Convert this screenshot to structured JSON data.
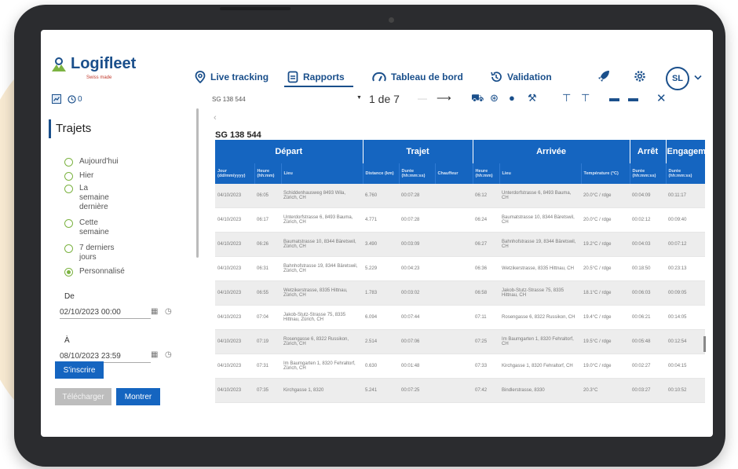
{
  "app": {
    "brand": "Logifleet",
    "brand_sub": "Swiss made",
    "user_initials": "SL"
  },
  "nav": {
    "items": [
      {
        "label": "Live tracking",
        "icon": "location-pin-icon"
      },
      {
        "label": "Rapports",
        "icon": "document-icon"
      },
      {
        "label": "Tableau de bord",
        "icon": "dashboard-icon"
      },
      {
        "label": "Validation",
        "icon": "history-icon"
      }
    ],
    "active": "Rapports"
  },
  "sidebar": {
    "counter": "0",
    "title": "Trajets",
    "periods": [
      "Aujourd'hui",
      "Hier",
      "La semaine dernière",
      "Cette semaine",
      "7 derniers jours",
      "Personnalisé"
    ],
    "selected_period": "Personnalisé",
    "from_label": "De",
    "from_value": "02/10/2023 00:00",
    "to_label": "À",
    "to_value": "08/10/2023 23:59",
    "subscribe_label": "S'inscrire",
    "download_label": "Télécharger",
    "show_label": "Montrer"
  },
  "toolbar": {
    "vehicle": "SG 138 544",
    "pager": "1 de 7"
  },
  "report": {
    "title": "SG 138 544",
    "groups": [
      {
        "label": "Départ",
        "span": 3
      },
      {
        "label": "Trajet",
        "span": 3
      },
      {
        "label": "Arrivée",
        "span": 3
      },
      {
        "label": "Arrêt",
        "span": 1
      },
      {
        "label": "Engageme",
        "span": 1
      }
    ],
    "columns": [
      "Jour (dd/mm/yyyy)",
      "Heure (hh:mm)",
      "Lieu",
      "Distance (km)",
      "Durée (hh:mm:ss)",
      "Chauffeur",
      "Heure (hh:mm)",
      "Lieu",
      "Température (°C)",
      "Durée (hh:mm:ss)",
      "Durée (hh:mm:ss)"
    ],
    "rows": [
      [
        "04/10/2023",
        "06:05",
        "Schiddenhausweg 8493 Wila, Zürich, CH",
        "6.760",
        "00:07:28",
        "",
        "06:12",
        "Unterdorfstrasse 6, 8493 Bauma, CH",
        "20.0°C / rdge",
        "00:04:09",
        "00:11:17"
      ],
      [
        "04/10/2023",
        "06:17",
        "Unterdorfstrasse 6, 8493 Bauma, Zürich, CH",
        "4.771",
        "00:07:28",
        "",
        "06:24",
        "Baumatstrasse 10, 8344 Bäretswil, CH",
        "20.0°C / rdge",
        "00:02:12",
        "00:09:40"
      ],
      [
        "04/10/2023",
        "06:26",
        "Baumatstrasse 10, 8344 Bäretswil, Zürich, CH",
        "3.490",
        "00:03:09",
        "",
        "06:27",
        "Bahnhofstrasse 19, 8344 Bäretswil, CH",
        "19.2°C / rdge",
        "00:04:03",
        "00:07:12"
      ],
      [
        "04/10/2023",
        "06:31",
        "Bahnhofstrasse 19, 8344 Bäretswil, Zürich, CH",
        "5.229",
        "00:04:23",
        "",
        "06:36",
        "Wetzikerstrasse, 8335 Hittnau, CH",
        "20.5°C / rdge",
        "00:18:50",
        "00:23:13"
      ],
      [
        "04/10/2023",
        "06:55",
        "Wetzikerstrasse, 8335 Hittnau, Zürich, CH",
        "1.783",
        "00:03:02",
        "",
        "06:58",
        "Jakob-Stutz-Strasse 75, 8335 Hittnau, CH",
        "18.1°C / rdge",
        "00:06:03",
        "00:09:05"
      ],
      [
        "04/10/2023",
        "07:04",
        "Jakob-Stutz-Strasse 75, 8335 Hittnau, Zürich, CH",
        "6.094",
        "00:07:44",
        "",
        "07:11",
        "Rosengasse 6, 8322 Russikon, CH",
        "19.4°C / rdge",
        "00:06:21",
        "00:14:05"
      ],
      [
        "04/10/2023",
        "07:19",
        "Rosengasse 6, 8322 Russikon, Zürich, CH",
        "2.514",
        "00:07:06",
        "",
        "07:25",
        "Im Baumgarten 1, 8320 Fehraltorf, CH",
        "19.5°C / rdge",
        "00:05:48",
        "00:12:54"
      ],
      [
        "04/10/2023",
        "07:31",
        "Im Baumgarten 1, 8320 Fehraltorf, Zürich, CH",
        "0.630",
        "00:01:48",
        "",
        "07:33",
        "Kirchgasse 1, 8320 Fehraltorf, CH",
        "19.0°C / rdge",
        "00:02:27",
        "00:04:15"
      ],
      [
        "04/10/2023",
        "07:35",
        "Kirchgasse 1, 8320",
        "5.241",
        "00:07:25",
        "",
        "07:42",
        "Bindlerstrasse, 8330",
        "20.3°C",
        "00:03:27",
        "00:10:52"
      ]
    ]
  }
}
